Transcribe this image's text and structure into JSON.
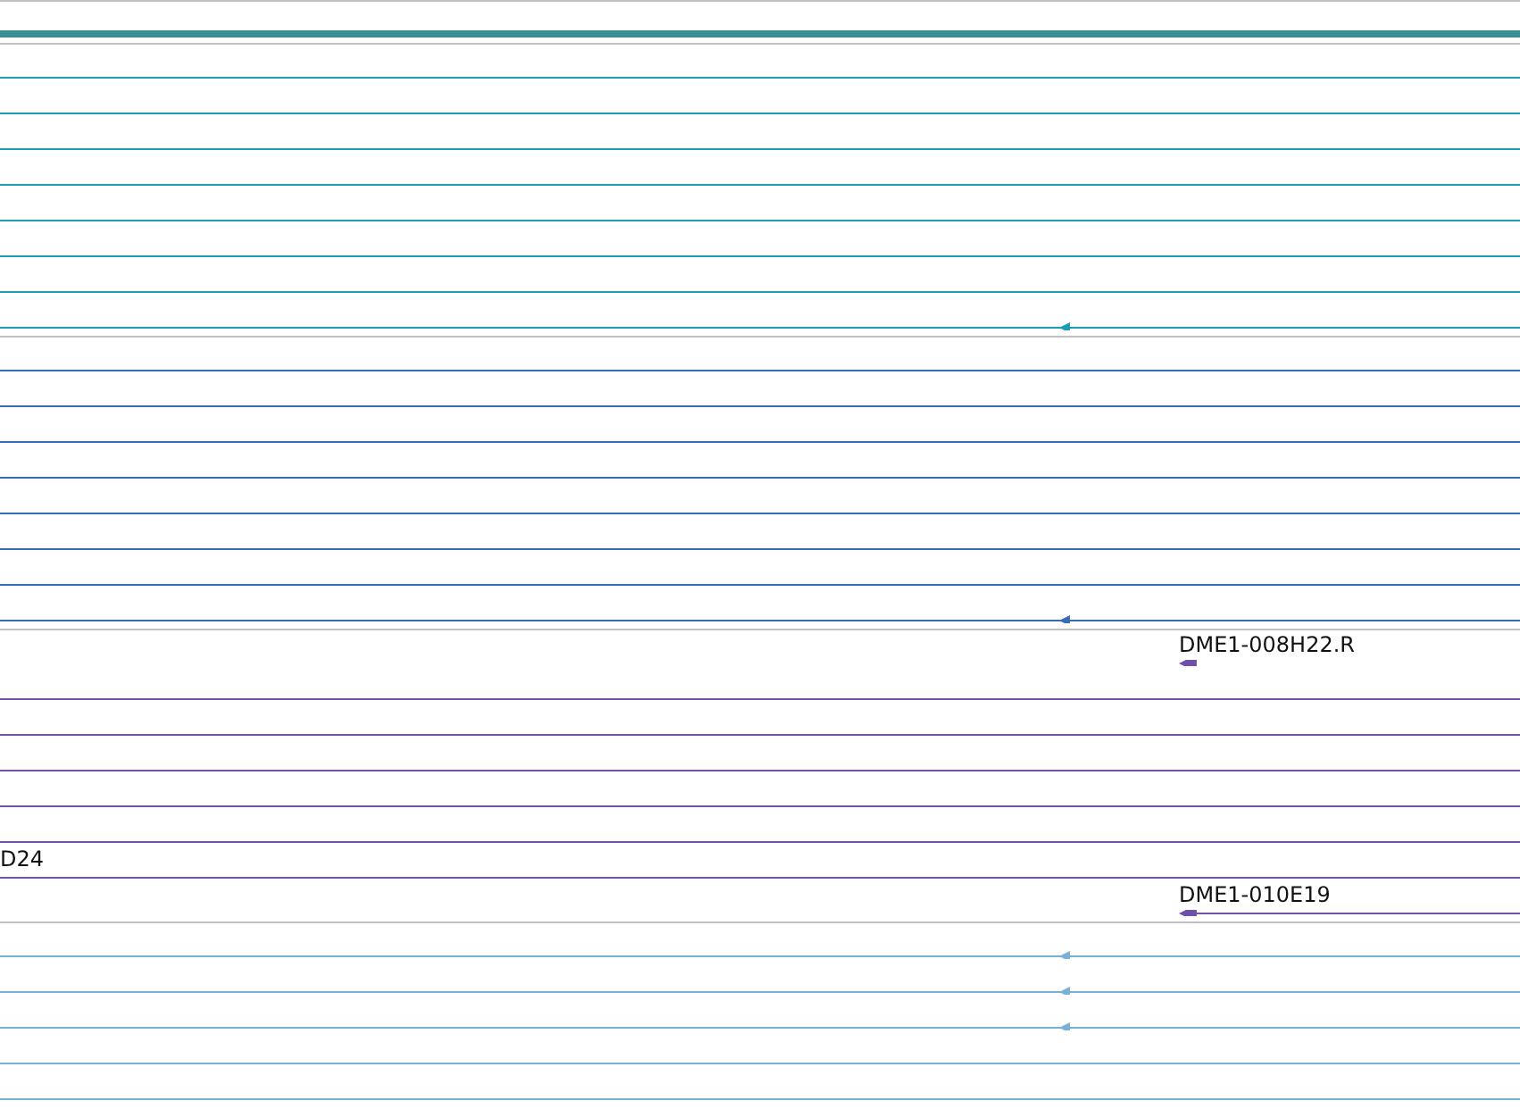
{
  "tracks": [
    {
      "color": "#1a9cb4",
      "rows": [
        {
          "kind": "line"
        },
        {
          "kind": "line"
        },
        {
          "kind": "line"
        },
        {
          "kind": "line"
        },
        {
          "kind": "line"
        },
        {
          "kind": "line"
        },
        {
          "kind": "line"
        },
        {
          "kind": "line-strand"
        }
      ]
    },
    {
      "color": "#3a6ab8",
      "rows": [
        {
          "kind": "line"
        },
        {
          "kind": "line"
        },
        {
          "kind": "line"
        },
        {
          "kind": "line"
        },
        {
          "kind": "line"
        },
        {
          "kind": "line"
        },
        {
          "kind": "line"
        },
        {
          "kind": "line-strand"
        }
      ]
    },
    {
      "color": "#7050a8",
      "rows": [
        {
          "kind": "feature",
          "label": "DME1-008H22.R"
        },
        {
          "kind": "line"
        },
        {
          "kind": "line"
        },
        {
          "kind": "line"
        },
        {
          "kind": "line"
        },
        {
          "kind": "line"
        },
        {
          "kind": "label-line",
          "label": "D24"
        },
        {
          "kind": "feature-long",
          "label": "DME1-010E19"
        }
      ]
    },
    {
      "color": "#7ab0d8",
      "rows": [
        {
          "kind": "line-strand"
        },
        {
          "kind": "line-strand"
        },
        {
          "kind": "line-strand"
        },
        {
          "kind": "line"
        },
        {
          "kind": "line"
        }
      ]
    }
  ]
}
